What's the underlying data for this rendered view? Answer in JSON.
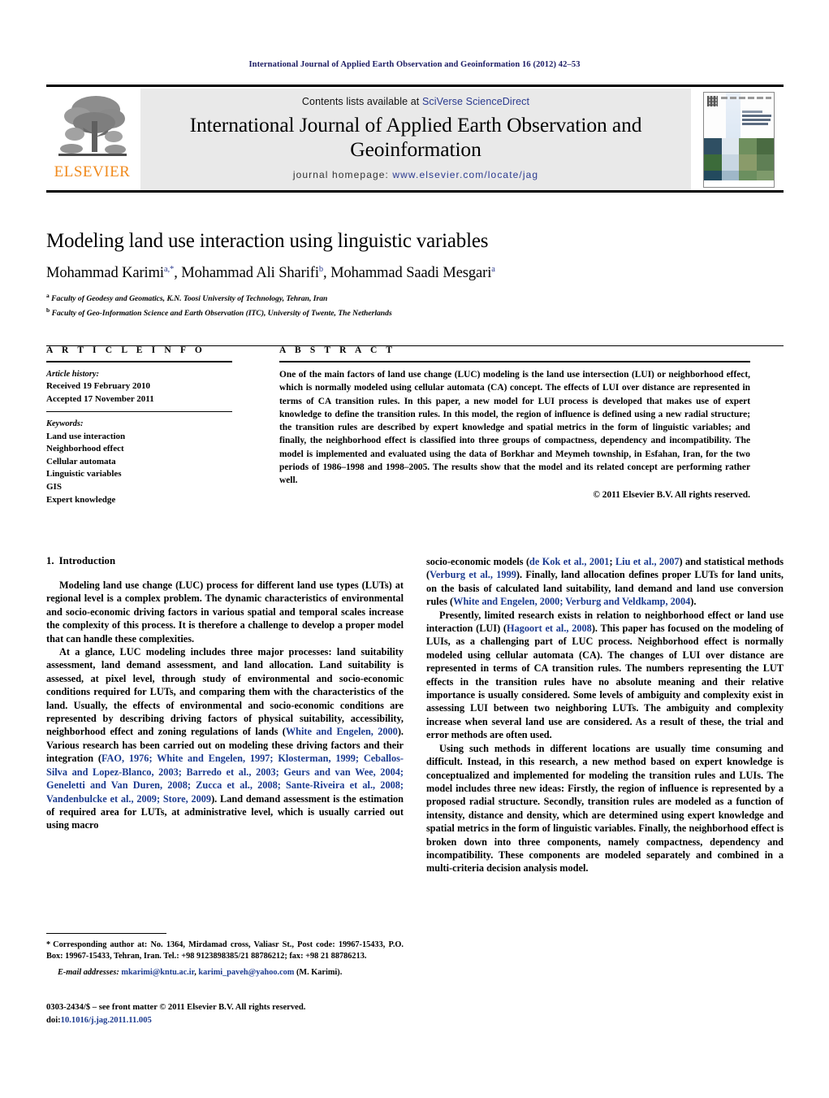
{
  "running_head": "International Journal of Applied Earth Observation and Geoinformation 16 (2012) 42–53",
  "masthead": {
    "contents_prefix": "Contents lists available at ",
    "contents_link": "SciVerse ScienceDirect",
    "journal_title": "International Journal of Applied Earth Observation and Geoinformation",
    "homepage_label": "journal homepage: ",
    "homepage_url": "www.elsevier.com/locate/jag",
    "publisher_logo_text": "ELSEVIER",
    "cover_alt": "journal-cover-thumbnail"
  },
  "article": {
    "title": "Modeling land use interaction using linguistic variables",
    "authors": [
      {
        "name": "Mohammad Karimi",
        "marks": "a,*"
      },
      {
        "name": "Mohammad Ali Sharifi",
        "marks": "b"
      },
      {
        "name": "Mohammad Saadi Mesgari",
        "marks": "a"
      }
    ],
    "authors_line": "Mohammad Karimi, Mohammad Ali Sharifi, Mohammad Saadi Mesgari",
    "affiliations": [
      {
        "mark": "a",
        "text": "Faculty of Geodesy and Geomatics, K.N. Toosi University of Technology, Tehran, Iran"
      },
      {
        "mark": "b",
        "text": "Faculty of Geo-Information Science and Earth Observation (ITC), University of Twente, The Netherlands"
      }
    ]
  },
  "article_info": {
    "heading": "A R T I C L E  I N F O",
    "history_label": "Article history:",
    "history": [
      "Received 19 February 2010",
      "Accepted 17 November 2011"
    ],
    "keywords_label": "Keywords:",
    "keywords": [
      "Land use interaction",
      "Neighborhood effect",
      "Cellular automata",
      "Linguistic variables",
      "GIS",
      "Expert knowledge"
    ]
  },
  "abstract": {
    "heading": "A B S T R A C T",
    "text": "One of the main factors of land use change (LUC) modeling is the land use intersection (LUI) or neighborhood effect, which is normally modeled using cellular automata (CA) concept. The effects of LUI over distance are represented in terms of CA transition rules. In this paper, a new model for LUI process is developed that makes use of expert knowledge to define the transition rules. In this model, the region of influence is defined using a new radial structure; the transition rules are described by expert knowledge and spatial metrics in the form of linguistic variables; and finally, the neighborhood effect is classified into three groups of compactness, dependency and incompatibility. The model is implemented and evaluated using the data of Borkhar and Meymeh township, in Esfahan, Iran, for the two periods of 1986–1998 and 1998–2005. The results show that the model and its related concept are performing rather well.",
    "copyright": "© 2011 Elsevier B.V. All rights reserved."
  },
  "body": {
    "section_number": "1.",
    "section_title": "Introduction",
    "left_paragraphs": [
      "Modeling land use change (LUC) process for different land use types (LUTs) at regional level is a complex problem. The dynamic characteristics of environmental and socio-economic driving factors in various spatial and temporal scales increase the complexity of this process. It is therefore a challenge to develop a proper model that can handle these complexities.",
      "At a glance, LUC modeling includes three major processes: land suitability assessment, land demand assessment, and land allocation. Land suitability is assessed, at pixel level, through study of environmental and socio-economic conditions required for LUTs, and comparing them with the characteristics of the land. Usually, the effects of environmental and socio-economic conditions are represented by describing driving factors of physical suitability, accessibility, neighborhood effect and zoning regulations of lands (White and Engelen, 2000). Various research has been carried out on modeling these driving factors and their integration (FAO, 1976; White and Engelen, 1997; Klosterman, 1999; Ceballos-Silva and Lopez-Blanco, 2003; Barredo et al., 2003; Geurs and van Wee, 2004; Geneletti and Van Duren, 2008; Zucca et al., 2008; Sante-Riveira et al., 2008; Vandenbulcke et al., 2009; Store, 2009). Land demand assessment is the estimation of required area for LUTs, at administrative level, which is usually carried out using macro"
    ],
    "right_paragraphs": [
      "socio-economic models (de Kok et al., 2001; Liu et al., 2007) and statistical methods (Verburg et al., 1999). Finally, land allocation defines proper LUTs for land units, on the basis of calculated land suitability, land demand and land use conversion rules (White and Engelen, 2000; Verburg and Veldkamp, 2004).",
      "Presently, limited research exists in relation to neighborhood effect or land use interaction (LUI) (Hagoort et al., 2008). This paper has focused on the modeling of LUIs, as a challenging part of LUC process. Neighborhood effect is normally modeled using cellular automata (CA). The changes of LUI over distance are represented in terms of CA transition rules. The numbers representing the LUT effects in the transition rules have no absolute meaning and their relative importance is usually considered. Some levels of ambiguity and complexity exist in assessing LUI between two neighboring LUTs. The ambiguity and complexity increase when several land use are considered. As a result of these, the trial and error methods are often used.",
      "Using such methods in different locations are usually time consuming and difficult. Instead, in this research, a new method based on expert knowledge is conceptualized and implemented for modeling the transition rules and LUIs. The model includes three new ideas: Firstly, the region of influence is represented by a proposed radial structure. Secondly, transition rules are modeled as a function of intensity, distance and density, which are determined using expert knowledge and spatial metrics in the form of linguistic variables. Finally, the neighborhood effect is broken down into three components, namely compactness, dependency and incompatibility. These components are modeled separately and combined in a multi-criteria decision analysis model."
    ],
    "citations_left": [
      "White and Engelen, 2000",
      "FAO, 1976; White and Engelen, 1997; Klosterman, 1999; Ceballos-Silva and Lopez-Blanco, 2003; Barredo et al., 2003; Geurs and van Wee, 2004; Geneletti and Van Duren, 2008; Zucca et al., 2008; Sante-Riveira et al., 2008; Vandenbulcke et al., 2009; Store, 2009"
    ],
    "citations_right": [
      "de Kok et al., 2001",
      "Liu et al., 2007",
      "Verburg et al., 1999",
      "White and Engelen, 2000; Verburg and Veldkamp, 2004",
      "Hagoort et al., 2008"
    ]
  },
  "footnote": {
    "star": "*",
    "corresponding": "Corresponding author at: No. 1364, Mirdamad cross, Valiasr St., Post code: 19967-15433, P.O. Box: 19967-15433, Tehran, Iran. Tel.: +98 9123898385/21 88786212; fax: +98 21 88786213.",
    "email_label": "E-mail addresses:",
    "email_1": "mkarimi@kntu.ac.ir",
    "email_2": "karimi_paveh@yahoo.com",
    "email_suffix": "(M. Karimi)."
  },
  "imprint": {
    "issn_line": "0303-2434/$ – see front matter © 2011 Elsevier B.V. All rights reserved.",
    "doi_label": "doi:",
    "doi_value": "10.1016/j.jag.2011.11.005"
  },
  "colors": {
    "link_blue": "#2b3a8f",
    "ref_blue": "#1b3a8f",
    "elsevier_orange": "#f08a1d",
    "masthead_grey": "#e9e9e9",
    "running_head_navy": "#1b1b63"
  }
}
